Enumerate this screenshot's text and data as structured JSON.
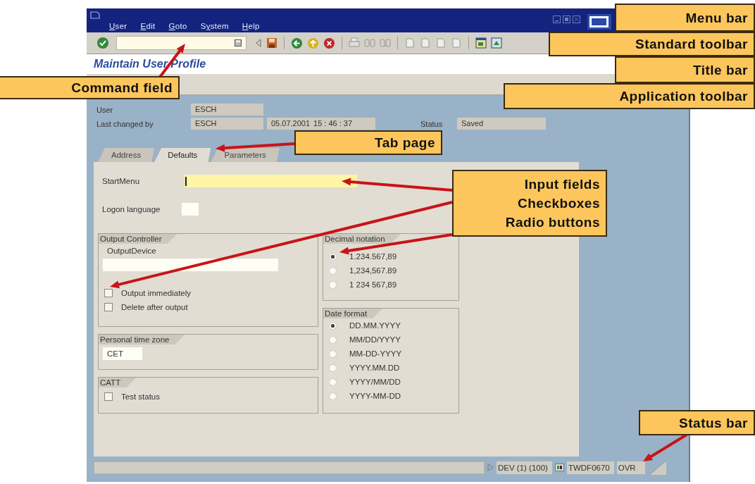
{
  "menu_bar": [
    {
      "key": "U",
      "rest": "ser"
    },
    {
      "key": "E",
      "rest": "dit"
    },
    {
      "key": "G",
      "rest": "oto"
    },
    {
      "before": "S",
      "key": "y",
      "rest": "stem"
    },
    {
      "key": "H",
      "rest": "elp"
    }
  ],
  "title_bar": {
    "title": "Maintain User Profile"
  },
  "header": [
    {
      "label": "User",
      "value": "ESCH"
    },
    {
      "label": "Last changed by",
      "value": "ESCH",
      "date": "05.07.2001",
      "time": "15 : 46 : 37",
      "status_label": "Status",
      "status": "Saved"
    }
  ],
  "tabs": [
    {
      "label": "Address",
      "selected": false
    },
    {
      "label": "Defaults",
      "selected": true
    },
    {
      "label": "Parameters",
      "selected": false
    }
  ],
  "start_menu": {
    "label": "StartMenu",
    "focused": true
  },
  "logon_language": {
    "label": "Logon language"
  },
  "output_controller": {
    "title": "Output Controller",
    "device_label": "OutputDevice",
    "checkboxes": [
      {
        "label": "Output immediately",
        "checked": false
      },
      {
        "label": "Delete after output",
        "checked": false
      }
    ]
  },
  "personal_time_zone": {
    "title": "Personal time zone",
    "value": "CET"
  },
  "catt": {
    "title": "CATT",
    "checkboxes": [
      {
        "label": "Test status",
        "checked": false
      }
    ]
  },
  "decimal_notation": {
    "title": "Decimal notation",
    "options": [
      {
        "label": "1.234.567,89",
        "selected": true
      },
      {
        "label": "1,234,567.89",
        "selected": false
      },
      {
        "label": "1 234 567,89",
        "selected": false
      }
    ]
  },
  "date_format": {
    "title": "Date format",
    "options": [
      {
        "label": "DD.MM.YYYY",
        "selected": true
      },
      {
        "label": "MM/DD/YYYY",
        "selected": false
      },
      {
        "label": "MM-DD-YYYY",
        "selected": false
      },
      {
        "label": "YYYY.MM.DD",
        "selected": false
      },
      {
        "label": "YYYY/MM/DD",
        "selected": false
      },
      {
        "label": "YYYY-MM-DD",
        "selected": false
      }
    ]
  },
  "status_bar": {
    "system": "DEV (1) (100)",
    "server": "TWDF0670",
    "mode": "OVR"
  },
  "callouts": [
    {
      "kind": "menu",
      "lines": [
        "Menu bar"
      ]
    },
    {
      "kind": "toolbar",
      "lines": [
        "Standard toolbar"
      ]
    },
    {
      "kind": "title",
      "lines": [
        "Title bar"
      ]
    },
    {
      "kind": "apptoolbar",
      "lines": [
        "Application toolbar"
      ]
    },
    {
      "kind": "command",
      "lines": [
        "Command field"
      ]
    },
    {
      "kind": "tab",
      "lines": [
        "Tab page"
      ]
    },
    {
      "kind": "inputs",
      "lines": [
        "Input fields",
        "Checkboxes",
        "Radio buttons"
      ]
    },
    {
      "kind": "status",
      "lines": [
        "Status bar"
      ]
    }
  ]
}
